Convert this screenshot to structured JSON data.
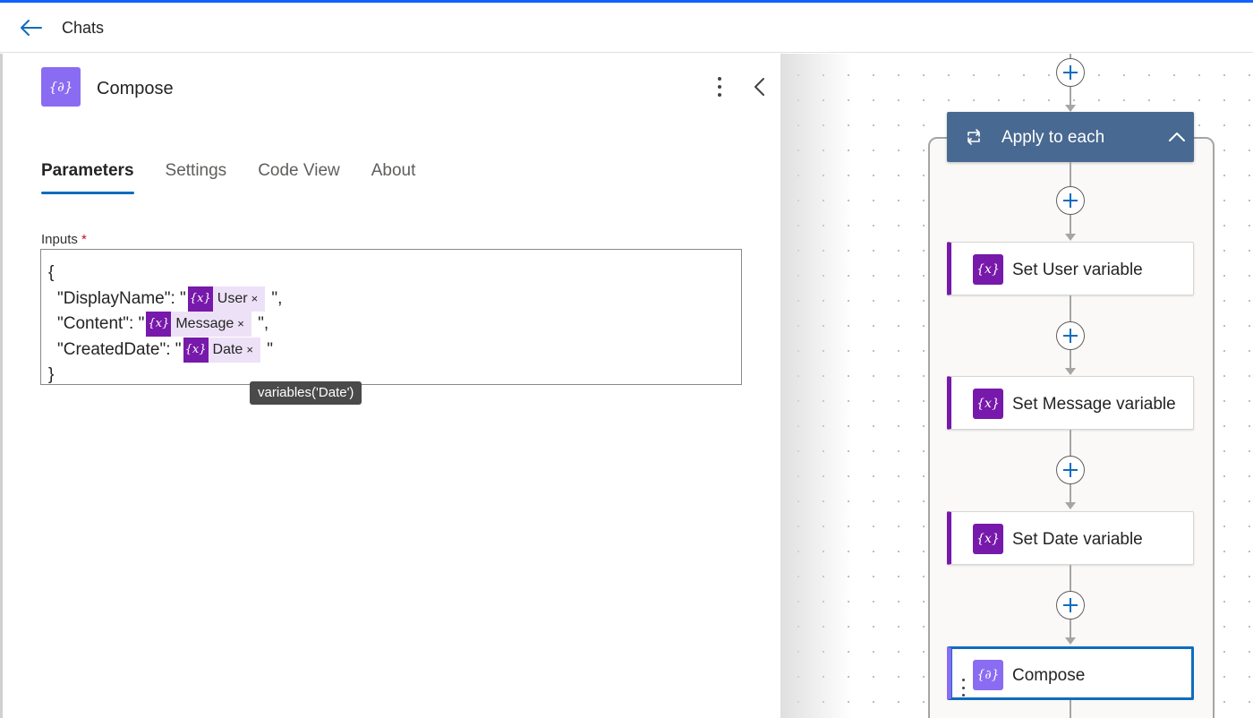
{
  "topbar": {
    "back_icon": "arrow-left-icon",
    "title": "Chats",
    "accent": "#0f62fe"
  },
  "panel": {
    "title": "Compose",
    "icon": "compose-icon",
    "tabs": [
      {
        "label": "Parameters",
        "active": true
      },
      {
        "label": "Settings",
        "active": false
      },
      {
        "label": "Code View",
        "active": false
      },
      {
        "label": "About",
        "active": false
      }
    ],
    "inputs_label": "Inputs",
    "required_marker": "*",
    "editor": {
      "open_brace": "{",
      "close_brace": "}",
      "lines": [
        {
          "prefix": "\"DisplayName\": \"",
          "token": "User",
          "suffix": " \","
        },
        {
          "prefix": "\"Content\": \"",
          "token": "Message",
          "suffix": " \","
        },
        {
          "prefix": "\"CreatedDate\": \"",
          "token": "Date",
          "suffix": " \""
        }
      ],
      "token_icon_text": "{x}",
      "token_remove": "×"
    },
    "tooltip": "variables('Date')"
  },
  "canvas": {
    "loop": {
      "label": "Apply to each",
      "color": "#486991"
    },
    "actions": [
      {
        "label": "Set User variable"
      },
      {
        "label": "Set Message variable"
      },
      {
        "label": "Set Date variable"
      },
      {
        "label": "Compose",
        "selected": true
      }
    ],
    "variable_icon_text": "{x}",
    "compose_icon_text": "{∂}",
    "variable_color": "#7719aa",
    "compose_color": "#8a6cf2"
  }
}
